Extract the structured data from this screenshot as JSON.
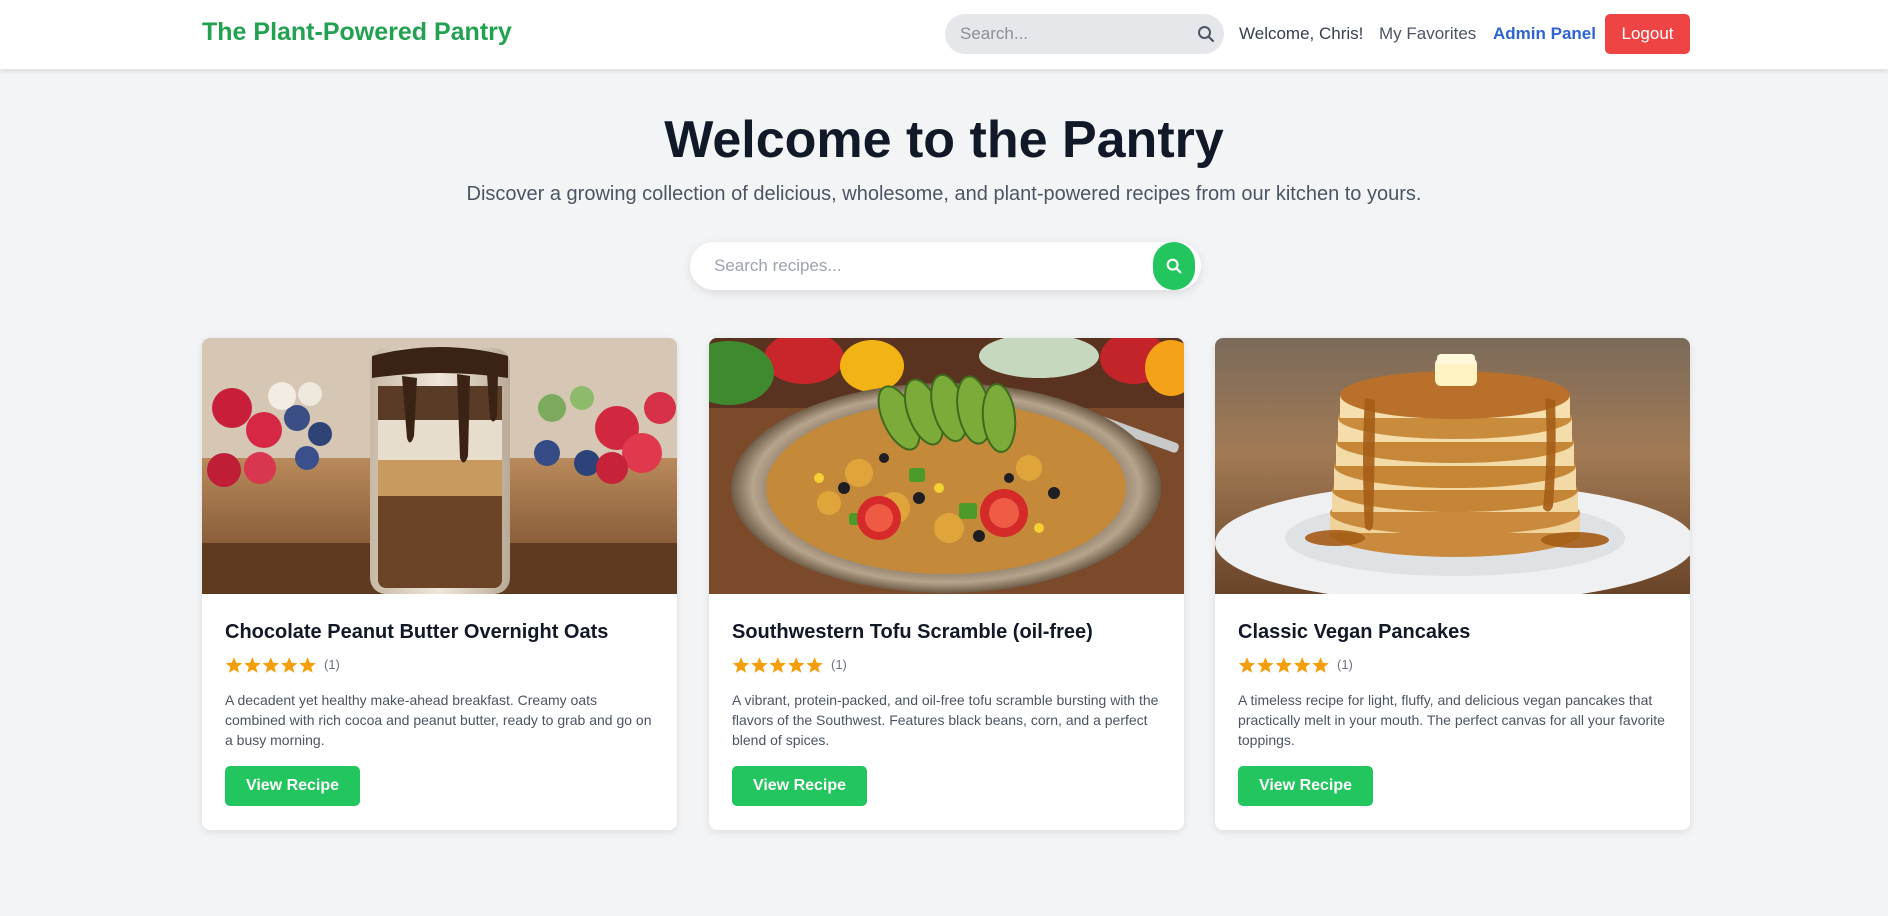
{
  "header": {
    "brand": "The Plant-Powered Pantry",
    "search_placeholder": "Search...",
    "welcome": "Welcome, Chris!",
    "favorites_label": "My Favorites",
    "admin_label": "Admin Panel",
    "logout_label": "Logout"
  },
  "hero": {
    "title": "Welcome to the Pantry",
    "subtitle": "Discover a growing collection of delicious, wholesome, and plant-powered recipes from our kitchen to yours.",
    "search_placeholder": "Search recipes..."
  },
  "recipes": [
    {
      "title": "Chocolate Peanut Butter Overnight Oats",
      "stars": 5,
      "rating_count": "(1)",
      "description": "A decadent yet healthy make-ahead breakfast. Creamy oats combined with rich cocoa and peanut butter, ready to grab and go on a busy morning.",
      "button": "View Recipe"
    },
    {
      "title": "Southwestern Tofu Scramble (oil-free)",
      "stars": 5,
      "rating_count": "(1)",
      "description": "A vibrant, protein-packed, and oil-free tofu scramble bursting with the flavors of the Southwest. Features black beans, corn, and a perfect blend of spices.",
      "button": "View Recipe"
    },
    {
      "title": "Classic Vegan Pancakes",
      "stars": 5,
      "rating_count": "(1)",
      "description": "A timeless recipe for light, fluffy, and delicious vegan pancakes that practically melt in your mouth. The perfect canvas for all your favorite toppings.",
      "button": "View Recipe"
    }
  ],
  "colors": {
    "brand_green": "#22a150",
    "button_green": "#22c55e",
    "logout_red": "#ef4444",
    "admin_blue": "#2f63d1",
    "star_orange": "#f59e0b",
    "background": "#f3f4f6"
  },
  "icons": {
    "nav_search": "search-icon",
    "hero_search": "search-icon",
    "rating": "star-icon"
  }
}
